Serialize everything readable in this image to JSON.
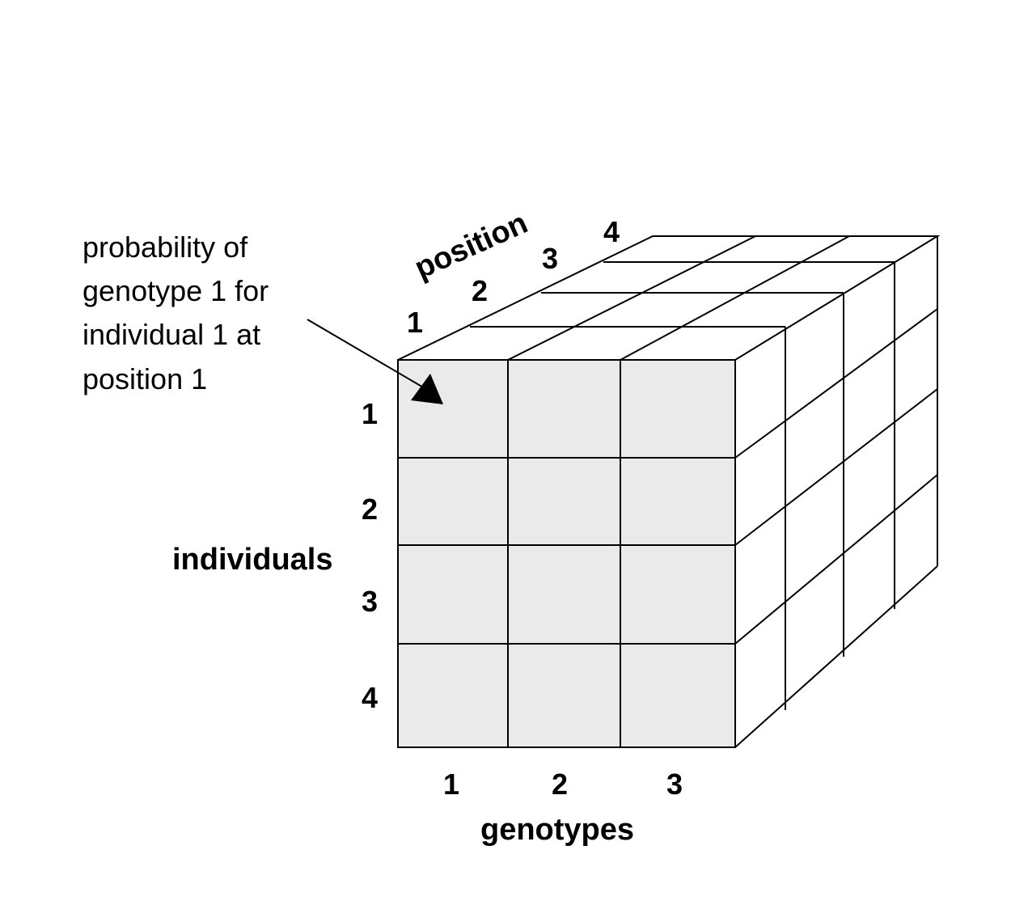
{
  "annotation": {
    "lines": [
      "probability of",
      "genotype 1 for",
      "individual 1 at",
      "position 1"
    ]
  },
  "axes": {
    "position": {
      "label": "position",
      "ticks": [
        "1",
        "2",
        "3",
        "4"
      ]
    },
    "individuals": {
      "label": "individuals",
      "ticks": [
        "1",
        "2",
        "3",
        "4"
      ]
    },
    "genotypes": {
      "label": "genotypes",
      "ticks": [
        "1",
        "2",
        "3"
      ]
    }
  },
  "colors": {
    "front_face": "#eaeaea",
    "lines": "#000000",
    "background": "#ffffff"
  }
}
